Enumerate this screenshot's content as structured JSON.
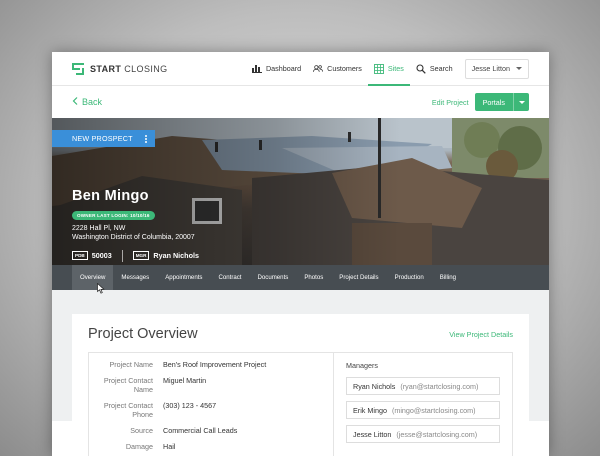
{
  "nav": {
    "logo_bold": "START",
    "logo_light": "CLOSING",
    "items": [
      {
        "label": "Dashboard",
        "icon": "bar-chart-icon",
        "active": false
      },
      {
        "label": "Customers",
        "icon": "users-icon",
        "active": false
      },
      {
        "label": "Sites",
        "icon": "grid-icon",
        "active": true
      },
      {
        "label": "Search",
        "icon": "search-icon",
        "active": false
      }
    ],
    "user": "Jesse Litton"
  },
  "subbar": {
    "back": "Back",
    "edit": "Edit Project",
    "portals": "Portals"
  },
  "hero": {
    "badge": "NEW PROSPECT",
    "name": "Ben Mingo",
    "last_login": "OWNER LAST LOGIN: 10/10/16",
    "address_line1": "2228 Hall Pl, NW",
    "address_line2": "Washington District of Columbia, 20007",
    "pdb_tag": "PDB",
    "pdb_value": "50003",
    "mgr_tag": "MGR",
    "mgr_value": "Ryan Nichols"
  },
  "tabs": [
    "Overview",
    "Messages",
    "Appointments",
    "Contract",
    "Documents",
    "Photos",
    "Project Details",
    "Production",
    "Billing"
  ],
  "overview": {
    "title": "Project Overview",
    "view_details": "View Project Details",
    "fields": [
      {
        "label": "Project Name",
        "value": "Ben's Roof Improvement Project"
      },
      {
        "label": "Project Contact Name",
        "value": "Miguel Martin"
      },
      {
        "label": "Project Contact Phone",
        "value": "(303) 123 - 4567"
      },
      {
        "label": "Source",
        "value": "Commercial Call Leads"
      },
      {
        "label": "Damage",
        "value": "Hail"
      }
    ],
    "managers_title": "Managers",
    "managers": [
      {
        "name": "Ryan Nichols",
        "email": "(ryan@startclosing.com)"
      },
      {
        "name": "Erik Mingo",
        "email": "(mingo@startclosing.com)"
      },
      {
        "name": "Jesse Litton",
        "email": "(jesse@startclosing.com)"
      }
    ]
  },
  "colors": {
    "accent": "#3cb878",
    "badge": "#3a8fd9",
    "tabbar": "#474d52"
  }
}
